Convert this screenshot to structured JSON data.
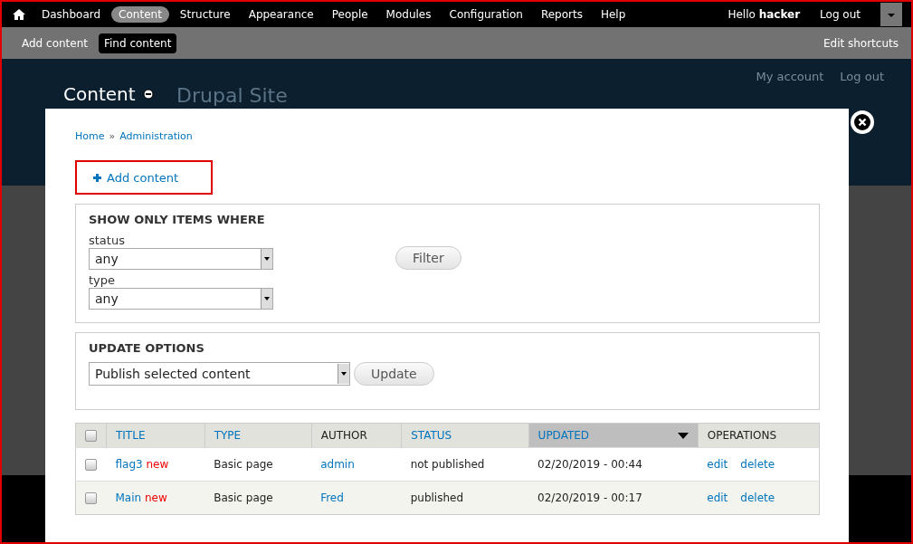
{
  "toolbar": {
    "menu": [
      {
        "label": "Dashboard",
        "selected": false
      },
      {
        "label": "Content",
        "selected": true
      },
      {
        "label": "Structure",
        "selected": false
      },
      {
        "label": "Appearance",
        "selected": false
      },
      {
        "label": "People",
        "selected": false
      },
      {
        "label": "Modules",
        "selected": false
      },
      {
        "label": "Configuration",
        "selected": false
      },
      {
        "label": "Reports",
        "selected": false
      },
      {
        "label": "Help",
        "selected": false
      }
    ],
    "greeting": "Hello **hacker**",
    "logout": "Log out"
  },
  "shortcuts": {
    "items": [
      {
        "label": "Add content",
        "selected": false
      },
      {
        "label": "Find content",
        "selected": true
      }
    ],
    "edit": "Edit shortcuts"
  },
  "site": {
    "name": "Drupal Site",
    "links": [
      "My account",
      "Log out"
    ]
  },
  "overlay": {
    "title": "Content",
    "breadcrumb": [
      "Home",
      "Administration"
    ],
    "breadcrumb_separator": "»",
    "action": "Add content",
    "filter": {
      "heading": "SHOW ONLY ITEMS WHERE",
      "fields": [
        {
          "label": "status",
          "value": "any"
        },
        {
          "label": "type",
          "value": "any"
        }
      ],
      "button": "Filter"
    },
    "update": {
      "heading": "UPDATE OPTIONS",
      "value": "Publish selected content",
      "button": "Update"
    },
    "table": {
      "header_checked": false,
      "columns": [
        {
          "label": "TITLE",
          "kind": "link",
          "selected": false
        },
        {
          "label": "TYPE",
          "kind": "link",
          "selected": false
        },
        {
          "label": "AUTHOR",
          "kind": "plain",
          "selected": false
        },
        {
          "label": "STATUS",
          "kind": "link",
          "selected": false
        },
        {
          "label": "UPDATED",
          "kind": "link",
          "selected": true
        },
        {
          "label": "OPERATIONS",
          "kind": "plain",
          "selected": false
        }
      ],
      "rows": [
        {
          "checked": false,
          "title": "flag3",
          "marker": "new",
          "type": "Basic page",
          "author": "admin",
          "status": "not published",
          "updated": "02/20/2019 - 00:44",
          "operations": [
            "edit",
            "delete"
          ]
        },
        {
          "checked": false,
          "title": "Main",
          "marker": "new",
          "type": "Basic page",
          "author": "Fred",
          "status": "published",
          "updated": "02/20/2019 - 00:17",
          "operations": [
            "edit",
            "delete"
          ]
        }
      ]
    }
  }
}
